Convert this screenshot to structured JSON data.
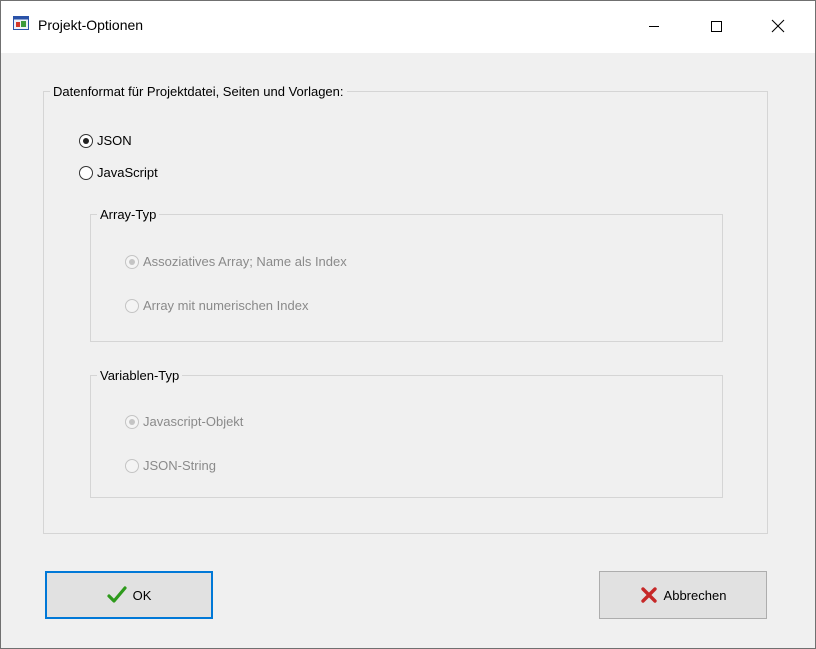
{
  "window": {
    "title": "Projekt-Optionen",
    "controls": {
      "minimize": "minimize-icon",
      "maximize": "maximize-icon",
      "close": "close-icon"
    }
  },
  "format_group": {
    "legend": "Datenformat für Projektdatei, Seiten und Vorlagen:",
    "options": [
      {
        "label": "JSON",
        "checked": true,
        "enabled": true
      },
      {
        "label": "JavaScript",
        "checked": false,
        "enabled": true
      }
    ]
  },
  "array_group": {
    "legend": "Array-Typ",
    "options": [
      {
        "label": "Assoziatives Array; Name als Index",
        "checked": true,
        "enabled": false
      },
      {
        "label": "Array mit numerischen Index",
        "checked": false,
        "enabled": false
      }
    ]
  },
  "variable_group": {
    "legend": "Variablen-Typ",
    "options": [
      {
        "label": "Javascript-Objekt",
        "checked": true,
        "enabled": false
      },
      {
        "label": "JSON-String",
        "checked": false,
        "enabled": false
      }
    ]
  },
  "buttons": {
    "ok_label": "OK",
    "cancel_label": "Abbrechen"
  },
  "colors": {
    "focus_border": "#0078d7",
    "ok_check": "#2e9a1c",
    "cancel_x": "#c62828"
  }
}
